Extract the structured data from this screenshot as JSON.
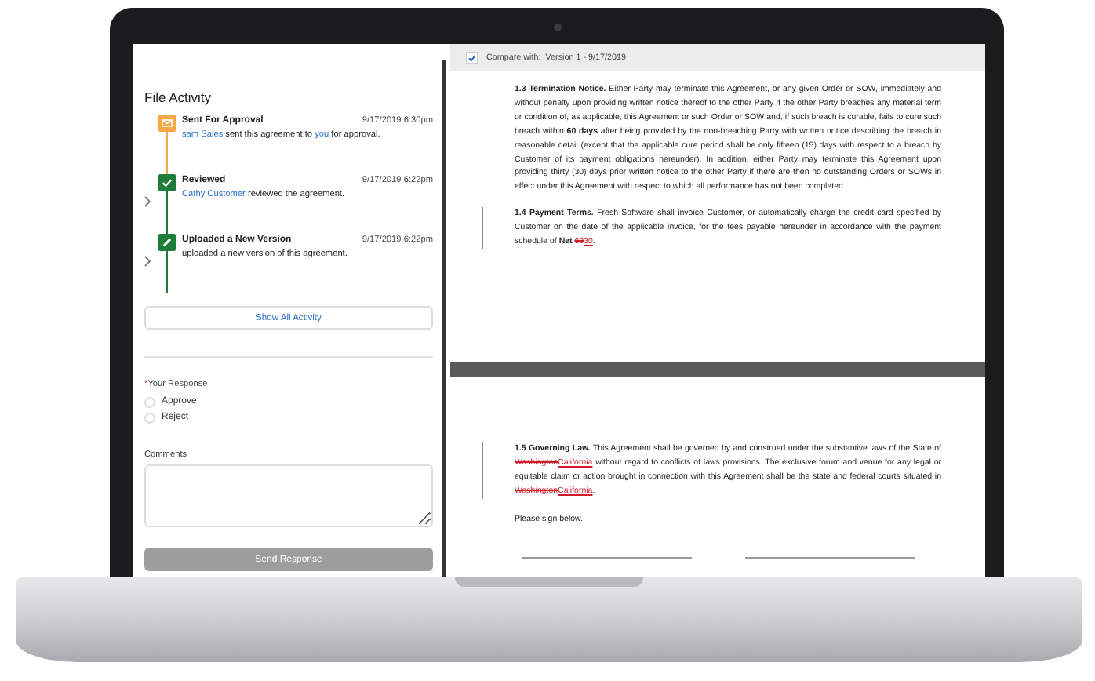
{
  "activity": {
    "title": "File Activity",
    "items": [
      {
        "kind": "envelope",
        "color": "#f4a742",
        "expandable": false,
        "title": "Sent For Approval",
        "time": "9/17/2019 6:30pm",
        "description": [
          {
            "kind": "link",
            "text": "sam Sales"
          },
          {
            "kind": "text",
            "text": " sent this agreement to "
          },
          {
            "kind": "link",
            "text": "you"
          },
          {
            "kind": "text",
            "text": " for approval."
          }
        ]
      },
      {
        "kind": "check",
        "color": "#1e7d3a",
        "expandable": true,
        "title": "Reviewed",
        "time": "9/17/2019 6:22pm",
        "description": [
          {
            "kind": "link",
            "text": "Cathy Customer"
          },
          {
            "kind": "text",
            "text": " reviewed the agreement."
          }
        ]
      },
      {
        "kind": "pencil",
        "color": "#1e7d3a",
        "expandable": true,
        "title": "Uploaded a New Version",
        "time": "9/17/2019 6:22pm",
        "description": [
          {
            "kind": "text",
            "text": "uploaded a new version of this agreement."
          }
        ]
      }
    ],
    "show_all": "Show All Activity"
  },
  "response": {
    "label": "Your Response",
    "required_mark": "*",
    "options": [
      {
        "label": "Approve",
        "selected": false
      },
      {
        "label": "Reject",
        "selected": false
      }
    ],
    "comments_label": "Comments",
    "submit": {
      "label": "Send Response",
      "disabled": true
    }
  },
  "compare": {
    "checked": true,
    "label": "Compare with:",
    "value": "Version 1 - 9/17/2019"
  },
  "pages": [
    {
      "paragraphs": [
        {
          "changed": false,
          "segments": [
            {
              "kind": "bold",
              "text": "1.3 Termination Notice."
            },
            {
              "kind": "text",
              "text": " Either Party may terminate this Agreement, or any given Order or SOW, immediately and without penalty upon providing written notice thereof to the other Party if the other Party breaches any material term or condition of, as applicable, this Agreement or such Order or SOW and, if such breach is curable, fails to cure such breach within "
            },
            {
              "kind": "bold",
              "text": "60 days"
            },
            {
              "kind": "text",
              "text": " after being provided by the non-breaching Party with written notice describing the breach in reasonable detail (except that the applicable cure period shall be only fifteen (15) days with respect to a breach by Customer of its payment obligations hereunder). In addition, either Party may terminate this Agreement upon providing thirty (30) days prior written notice to the other Party if there are then no outstanding Orders or SOWs in effect under this Agreement with respect to which all performance has not been completed."
            }
          ]
        },
        {
          "changed": true,
          "segments": [
            {
              "kind": "bold",
              "text": "1.4 Payment Terms."
            },
            {
              "kind": "text",
              "text": " Fresh Software shall invoice Customer, or automatically charge the credit card specified by Customer on the date of the applicable invoice, for the fees payable hereunder in accordance with the payment schedule of "
            },
            {
              "kind": "bold",
              "text": "Net "
            },
            {
              "kind": "deleted",
              "text": "60"
            },
            {
              "kind": "inserted",
              "text": "30"
            },
            {
              "kind": "text",
              "text": "."
            }
          ]
        }
      ]
    },
    {
      "paragraphs": [
        {
          "changed": true,
          "segments": [
            {
              "kind": "bold",
              "text": "1.5 Governing Law."
            },
            {
              "kind": "text",
              "text": "  This Agreement shall be governed by and construed under the substantive laws of the State of "
            },
            {
              "kind": "deleted",
              "text": "Washington"
            },
            {
              "kind": "inserted",
              "text": "California"
            },
            {
              "kind": "text",
              "text": " without regard to conflicts of laws provisions. The exclusive forum and venue for any legal or equitable claim or action brought in connection with this Agreement shall be the state and federal courts situated in "
            },
            {
              "kind": "deleted",
              "text": "Washington"
            },
            {
              "kind": "inserted",
              "text": "California"
            },
            {
              "kind": "text",
              "text": "."
            }
          ]
        },
        {
          "changed": false,
          "segments": [
            {
              "kind": "text",
              "text": "Please sign below."
            }
          ]
        }
      ],
      "signature_lines": true
    }
  ]
}
